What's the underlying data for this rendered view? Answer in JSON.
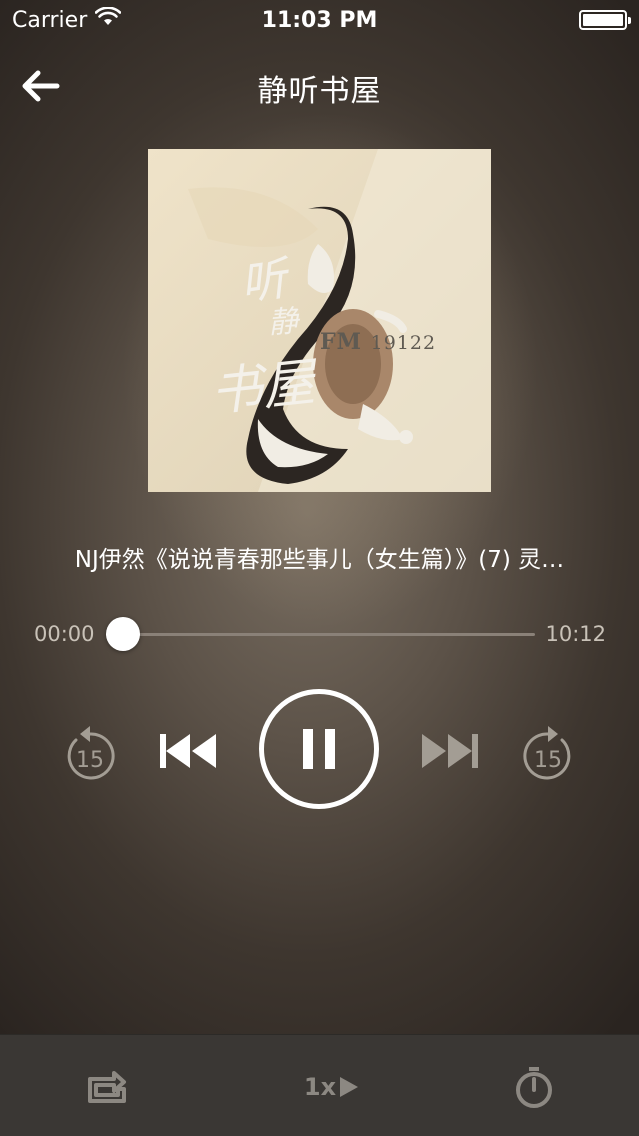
{
  "status_bar": {
    "carrier": "Carrier",
    "time": "11:03 PM"
  },
  "nav": {
    "title": "静听书屋"
  },
  "album_art": {
    "overlay_chars": [
      "听",
      "静",
      "书屋"
    ],
    "fm_label": "FM",
    "fm_number": "19122"
  },
  "player": {
    "track_title": "NJ伊然《说说青春那些事儿（女生篇）》(7) 灵…",
    "current_time": "00:00",
    "total_time": "10:12",
    "progress": 0.0,
    "state": "playing"
  },
  "controls": {
    "rewind_seconds": "15",
    "forward_seconds": "15"
  },
  "toolbar": {
    "speed_label": "1x"
  },
  "colors": {
    "accent": "#ffffff",
    "muted": "#8c8882",
    "toolbar_bg": "#3a3734"
  }
}
